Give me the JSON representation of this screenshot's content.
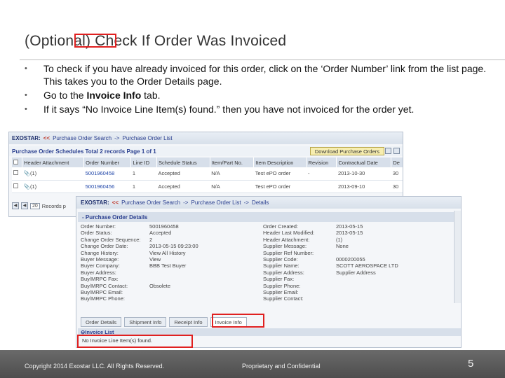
{
  "slide": {
    "title": "(Optional) Check If Order Was Invoiced",
    "bullets": [
      {
        "text": "To check if you have already invoiced for this order, click on the ‘Order Number’ link from the list page.  This takes you to the Order Details page."
      },
      {
        "pre": "Go to the ",
        "bold": "Invoice Info",
        "post": " tab."
      },
      {
        "text": "If it says “No Invoice Line Item(s) found.” then you have not invoiced for the order yet."
      }
    ]
  },
  "list_screen": {
    "logo": "EXOSTAR:",
    "sep": "<<",
    "crumb1": "Purchase Order Search",
    "crumb_arrow": "->",
    "crumb2": "Purchase Order List",
    "title": "Purchase Order Schedules Total 2 records Page 1 of 1",
    "download_label": "Download Purchase Orders",
    "columns": [
      "Header Attachment",
      "Order Number",
      "Line ID",
      "Schedule Status",
      "Item/Part No.",
      "Item Description",
      "Revision",
      "Contractual Date",
      "De"
    ],
    "rows": [
      {
        "attachment": "(1)",
        "order_number": "5001960458",
        "line_id": "1",
        "status": "Accepted",
        "item": "N/A",
        "desc": "Test ePO order",
        "revision": "-",
        "date": "2013-10-30",
        "de": "30"
      },
      {
        "attachment": "(1)",
        "order_number": "5001960456",
        "line_id": "1",
        "status": "Accepted",
        "item": "N/A",
        "desc": "Test ePO order",
        "revision": "",
        "date": "2013-09-10",
        "de": "30"
      }
    ],
    "pager_value": "20",
    "pager_label": "Records p"
  },
  "details_screen": {
    "logo": "EXOSTAR:",
    "sep": "<<",
    "crumb1": "Purchase Order Search",
    "crumb2": "Purchase Order List",
    "crumb3": "Details",
    "crumb_arrow": "->",
    "section_title": "- Purchase Order Details",
    "fields": [
      {
        "l1": "Order Number:",
        "v1": "5001960458",
        "l2": "Order Created:",
        "v2": "2013-05-15"
      },
      {
        "l1": "Order Status:",
        "v1": "Accepted",
        "l2": "Header Last Modified:",
        "v2": "2013-05-15"
      },
      {
        "l1": "Change Order Sequence:",
        "v1": "2",
        "l2": "Header Attachment:",
        "v2": "(1)"
      },
      {
        "l1": "Change Order Date:",
        "v1": "2013-05-15 09:23:00",
        "l2": "Supplier Message:",
        "v2": "None"
      },
      {
        "l1": "Change History:",
        "v1": "View All History",
        "l2": "Supplier Ref Number:",
        "v2": ""
      },
      {
        "l1": "Buyer Message:",
        "v1": "View",
        "l2": "Supplier Code:",
        "v2": "0000200055"
      },
      {
        "l1": "Buyer Company:",
        "v1": "BBB Test Buyer",
        "l2": "Supplier Name:",
        "v2": "SCOTT AEROSPACE LTD"
      },
      {
        "l1": "Buyer Address:",
        "v1": "",
        "l2": "Supplier Address:",
        "v2": "Supplier Address"
      },
      {
        "l1": "Buy/MRPC Fax:",
        "v1": "",
        "l2": "Supplier Fax:",
        "v2": ""
      },
      {
        "l1": "Buy/MRPC Contact:",
        "v1": "Obsolete",
        "l2": "Supplier Phone:",
        "v2": ""
      },
      {
        "l1": "Buy/MRPC Email:",
        "v1": "",
        "l2": "Supplier Email:",
        "v2": ""
      },
      {
        "l1": "Buy/MRPC Phone:",
        "v1": "",
        "l2": "Supplier Contact:",
        "v2": ""
      }
    ],
    "tabs": [
      "Order Details",
      "Shipment Info",
      "Receipt Info",
      "Invoice Info"
    ],
    "invoice_list_title": "Invoice List",
    "invoice_list_msg": "No Invoice Line Item(s) found."
  },
  "footer": {
    "copyright": "Copyright 2014 Exostar LLC. All Rights Reserved.",
    "confidential": "Proprietary and Confidential",
    "page": "5"
  },
  "colors": {
    "highlight": "#e02020",
    "footer": "#5a5a5a",
    "link": "#1f45a8"
  }
}
